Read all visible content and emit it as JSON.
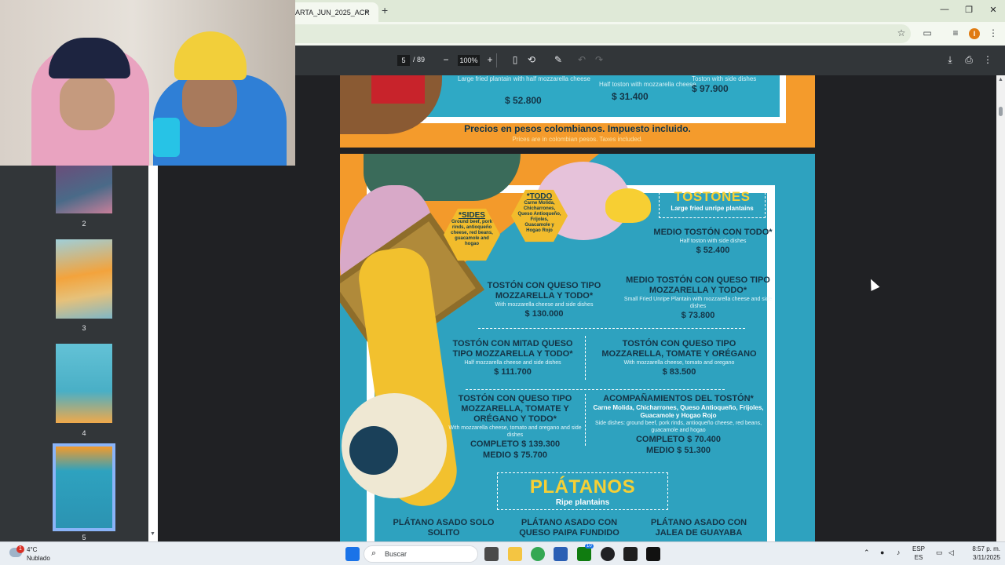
{
  "browser": {
    "tab_title": "ARTA_JUN_2025_ACR",
    "tab_close": "×",
    "new_tab": "+",
    "window_controls": [
      "—",
      "❐",
      "✕"
    ]
  },
  "pdf_toolbar": {
    "page_current": "5",
    "page_total": "/ 89",
    "zoom": "100%",
    "zoom_out": "−",
    "zoom_in": "+"
  },
  "sidebar": {
    "thumbnails": [
      {
        "number": "2"
      },
      {
        "number": "3"
      },
      {
        "number": "4"
      },
      {
        "number": "5",
        "selected": true
      }
    ]
  },
  "page4": {
    "items": [
      {
        "desc": "Large fried plantain with half mozzarella cheese",
        "price": "$ 52.800"
      },
      {
        "desc": "Half toston with mozzarella cheese",
        "price": "$ 31.400"
      },
      {
        "desc": "Toston with side dishes",
        "price": "$ 97.900"
      }
    ],
    "note": "Precios en pesos colombianos. Impuesto incluido.",
    "note_en": "Prices are in colombian pesos. Taxes included."
  },
  "page5": {
    "tostones_title": "TOSTONES",
    "tostones_subtitle": "Large fried unripe plantains",
    "badge_sides": {
      "title": "*SIDES",
      "desc": "Ground beef, pork rinds, antioqueño cheese, red beans, guacamole and hogao"
    },
    "badge_todo": {
      "title": "*TODO",
      "desc": "Carne Molida, Chicharrones, Queso Antioqueño, Frijoles, Guacamole y Hogao Rojo"
    },
    "items": {
      "medio_toston_todo": {
        "name": "MEDIO TOSTÓN CON TODO*",
        "desc": "Half toston with side dishes",
        "price": "$ 52.400"
      },
      "toston_mozz_todo": {
        "name": "TOSTÓN CON QUESO TIPO MOZZARELLA Y TODO*",
        "desc": "With mozzarella cheese and side dishes",
        "price": "$ 130.000"
      },
      "medio_toston_mozz_todo": {
        "name": "MEDIO TOSTÓN CON QUESO TIPO MOZZARELLA Y TODO*",
        "desc": "Small Fried Unripe Plantain with mozzarella cheese and side dishes",
        "price": "$ 73.800"
      },
      "toston_mitad_mozz_todo": {
        "name": "TOSTÓN CON MITAD QUESO TIPO MOZZARELLA Y TODO*",
        "desc": "Half mozzarella cheese and side dishes",
        "price": "$ 111.700"
      },
      "toston_mozz_tomate_oregano": {
        "name": "TOSTÓN CON QUESO TIPO MOZZARELLA, TOMATE Y ORÉGANO",
        "desc": "With mozzarella cheese, tomato and oregano",
        "price": "$ 83.500"
      },
      "toston_mozz_tomate_oregano_todo": {
        "name": "TOSTÓN CON QUESO TIPO MOZZARELLA, TOMATE Y ORÉGANO Y TODO*",
        "desc": "With mozzarella cheese, tomato and oregano and side dishes",
        "price_complete": "COMPLETO $ 139.300",
        "price_half": "MEDIO $ 75.700"
      },
      "acompanamientos": {
        "name": "ACOMPAÑAMIENTOS DEL TOSTÓN*",
        "sub": "Carne Molida, Chicharrones, Queso Antioqueño, Frijoles, Guacamole y Hogao Rojo",
        "desc": "Side dishes: ground beef, pork rinds, antioqueño cheese, red beans, guacamole and hogao",
        "price_complete": "COMPLETO $ 70.400",
        "price_half": "MEDIO $ 51.300"
      }
    },
    "platanos_title": "PLÁTANOS",
    "platanos_subtitle": "Ripe plantains",
    "platanos_items": [
      "PLÁTANO ASADO SOLO SOLITO",
      "PLÁTANO ASADO CON QUESO PAIPA FUNDIDO",
      "PLÁTANO ASADO CON JALEA DE GUAYABA"
    ]
  },
  "taskbar": {
    "weather_temp": "4°C",
    "weather_desc": "Nublado",
    "weather_badge": "1",
    "search_placeholder": "Buscar",
    "lang_top": "ESP",
    "lang_bottom": "ES",
    "time": "8:57 p. m.",
    "date": "3/11/2025",
    "xbox_badge": "10"
  },
  "colors": {
    "menu_teal": "#2ea2bf",
    "menu_orange": "#f39a2b",
    "menu_yellow": "#f6d035",
    "menu_navy": "#143446",
    "selected_thumb": "#8ab4f8"
  }
}
